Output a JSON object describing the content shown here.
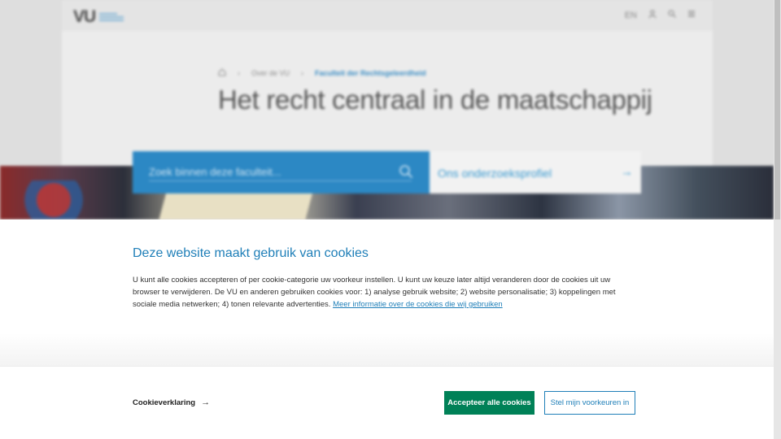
{
  "background": {
    "logo_text": "VU",
    "header_icons": {
      "lang": "EN",
      "user": "user-icon",
      "search": "search-icon",
      "menu": "menu-icon"
    },
    "breadcrumb": {
      "home": "home-icon",
      "item1": "Over de VU",
      "item2": "Faculteit der Rechtsgeleerdheid"
    },
    "hero_title": "Het recht centraal in de maatschappij",
    "search": {
      "placeholder": "Zoek binnen deze faculteit..."
    },
    "profile_link": "Ons onderzoeksprofiel"
  },
  "cookie_banner": {
    "title": "Deze website maakt gebruik van cookies",
    "body": "U kunt alle cookies accepteren of per cookie-categorie uw voorkeur instellen. U kunt uw keuze later altijd veranderen door de cookies uit uw browser te verwijderen. De VU en anderen gebruiken cookies voor: 1) analyse gebruik website; 2) website personalisatie; 3) koppelingen met sociale media netwerken; 4) tonen relevante advertenties.",
    "more_info_link": "Meer informatie over de cookies die wij gebruiken"
  },
  "actions": {
    "declaration_link": "Cookieverklaring",
    "accept_button": "Accepteer alle cookies",
    "preferences_button": "Stel mijn voorkeuren in"
  },
  "colors": {
    "brand_blue": "#1f7fb8",
    "accept_green": "#008157"
  }
}
